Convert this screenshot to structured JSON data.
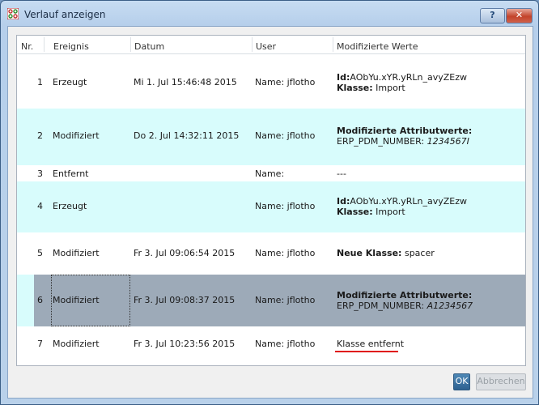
{
  "window": {
    "title": "Verlauf anzeigen",
    "help_label": "?",
    "close_label": "✕"
  },
  "table": {
    "headers": [
      "Nr.",
      "Ereignis",
      "Datum",
      "User",
      "Modifizierte Werte"
    ],
    "rows": [
      {
        "nr": "1",
        "ereignis": "Erzeugt",
        "datum": "Mi 1. Jul 15:46:48 2015",
        "user": "Name: jflotho",
        "werte": [
          {
            "bold": "Id:",
            "text": "AObYu.xYR.yRLn_avyZEzw"
          },
          {
            "bold": "Klasse:",
            "text": " Import"
          }
        ]
      },
      {
        "nr": "2",
        "ereignis": "Modifiziert",
        "datum": "Do 2. Jul 14:32:11 2015",
        "user": "Name: jflotho",
        "werte": [
          {
            "bold": "Modifizierte Attributwerte:",
            "text": ""
          },
          {
            "text": "ERP_PDM_NUMBER: ",
            "italic": "1234567I"
          }
        ]
      },
      {
        "nr": "3",
        "ereignis": "Entfernt",
        "datum": "",
        "user": "Name:",
        "werte": [
          {
            "text": "---"
          }
        ]
      },
      {
        "nr": "4",
        "ereignis": "Erzeugt",
        "datum": "",
        "user": "Name: jflotho",
        "werte": [
          {
            "bold": "Id:",
            "text": "AObYu.xYR.yRLn_avyZEzw"
          },
          {
            "bold": "Klasse:",
            "text": " Import"
          }
        ]
      },
      {
        "nr": "5",
        "ereignis": "Modifiziert",
        "datum": "Fr 3. Jul 09:06:54 2015",
        "user": "Name: jflotho",
        "werte": [
          {
            "bold": "Neue Klasse:",
            "text": " spacer"
          }
        ]
      },
      {
        "nr": "6",
        "ereignis": "Modifiziert",
        "datum": "Fr 3. Jul 09:08:37 2015",
        "user": "Name: jflotho",
        "werte": [
          {
            "bold": "Modifizierte Attributwerte:",
            "text": ""
          },
          {
            "text": "ERP_PDM_NUMBER: ",
            "italic": "A1234567"
          }
        ]
      },
      {
        "nr": "7",
        "ereignis": "Modifiziert",
        "datum": "Fr 3. Jul 10:23:56 2015",
        "user": "Name: jflotho",
        "werte": [
          {
            "text": "Klasse entfernt"
          }
        ]
      }
    ]
  },
  "buttons": {
    "ok": "OK",
    "cancel": "Abbrechen"
  },
  "colors": {
    "alt_row": "#d8fcfc",
    "selected_row": "#9daab8",
    "annotation": "#e01010"
  }
}
